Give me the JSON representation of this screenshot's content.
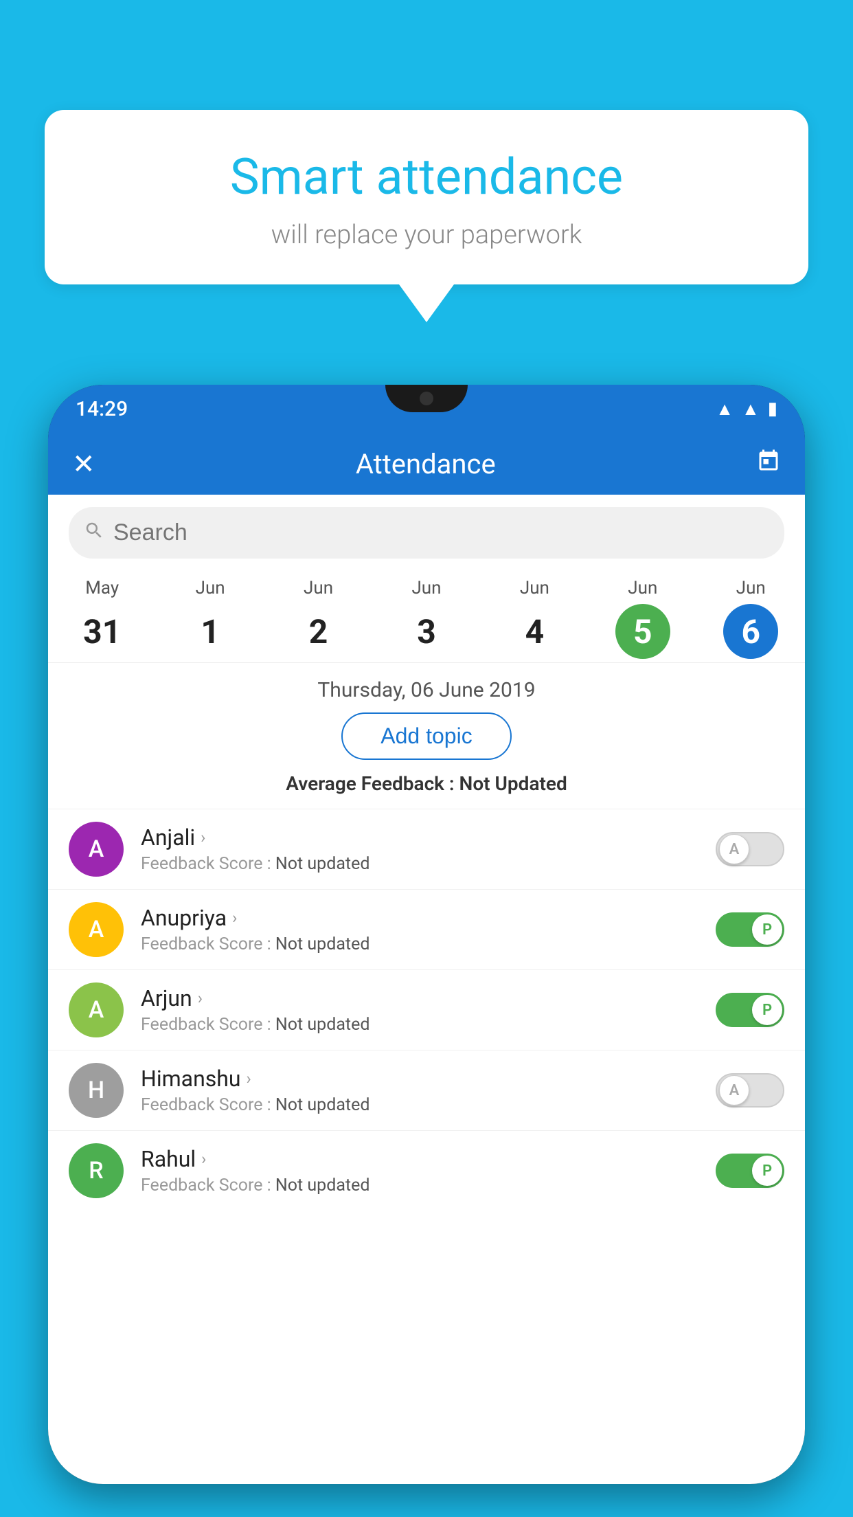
{
  "background_color": "#1ab9e8",
  "speech_bubble": {
    "title": "Smart attendance",
    "subtitle": "will replace your paperwork"
  },
  "phone": {
    "status_bar": {
      "time": "14:29",
      "icons": [
        "wifi",
        "signal",
        "battery"
      ]
    },
    "app_bar": {
      "close_label": "✕",
      "title": "Attendance",
      "calendar_icon": "📅"
    },
    "search": {
      "placeholder": "Search"
    },
    "calendar": {
      "days": [
        {
          "month": "May",
          "date": "31",
          "state": "normal"
        },
        {
          "month": "Jun",
          "date": "1",
          "state": "normal"
        },
        {
          "month": "Jun",
          "date": "2",
          "state": "normal"
        },
        {
          "month": "Jun",
          "date": "3",
          "state": "normal"
        },
        {
          "month": "Jun",
          "date": "4",
          "state": "normal"
        },
        {
          "month": "Jun",
          "date": "5",
          "state": "today"
        },
        {
          "month": "Jun",
          "date": "6",
          "state": "selected"
        }
      ]
    },
    "selected_date": "Thursday, 06 June 2019",
    "add_topic_label": "Add topic",
    "average_feedback": {
      "label": "Average Feedback : ",
      "value": "Not Updated"
    },
    "students": [
      {
        "name": "Anjali",
        "avatar_letter": "A",
        "avatar_color": "#9C27B0",
        "feedback_label": "Feedback Score : ",
        "feedback_value": "Not updated",
        "attendance": "absent",
        "toggle_letter": "A"
      },
      {
        "name": "Anupriya",
        "avatar_letter": "A",
        "avatar_color": "#FFC107",
        "feedback_label": "Feedback Score : ",
        "feedback_value": "Not updated",
        "attendance": "present",
        "toggle_letter": "P"
      },
      {
        "name": "Arjun",
        "avatar_letter": "A",
        "avatar_color": "#8BC34A",
        "feedback_label": "Feedback Score : ",
        "feedback_value": "Not updated",
        "attendance": "present",
        "toggle_letter": "P"
      },
      {
        "name": "Himanshu",
        "avatar_letter": "H",
        "avatar_color": "#9E9E9E",
        "feedback_label": "Feedback Score : ",
        "feedback_value": "Not updated",
        "attendance": "absent",
        "toggle_letter": "A"
      },
      {
        "name": "Rahul",
        "avatar_letter": "R",
        "avatar_color": "#4CAF50",
        "feedback_label": "Feedback Score : ",
        "feedback_value": "Not updated",
        "attendance": "present",
        "toggle_letter": "P"
      }
    ]
  }
}
